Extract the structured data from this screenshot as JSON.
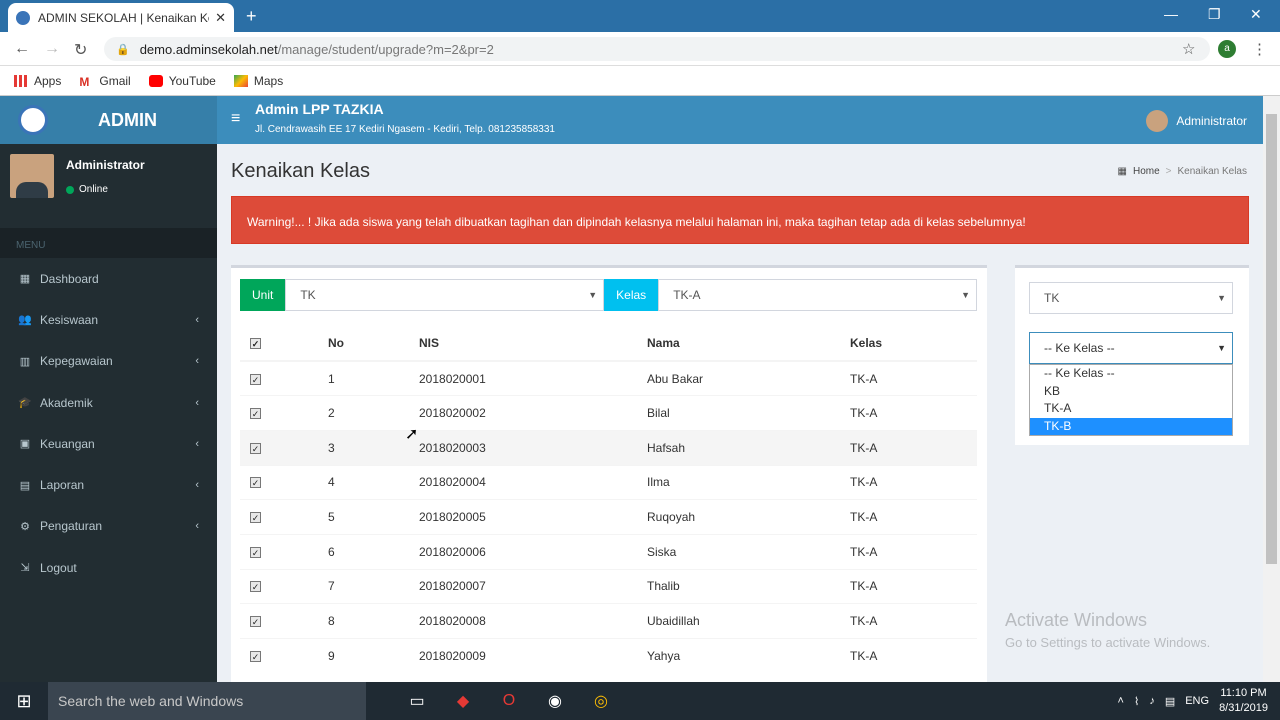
{
  "browser": {
    "tab_title": "ADMIN SEKOLAH | Kenaikan Kel",
    "url_host": "demo.adminsekolah.net",
    "url_path": "/manage/student/upgrade?m=2&pr=2",
    "bookmarks": [
      "Apps",
      "Gmail",
      "YouTube",
      "Maps"
    ],
    "profile_initial": "a"
  },
  "app": {
    "brand": "ADMIN",
    "header_title": "Admin LPP TAZKIA",
    "header_subtitle": "Jl. Cendrawasih EE 17 Kediri Ngasem - Kediri, Telp. 081235858331",
    "header_user": "Administrator"
  },
  "sidebar": {
    "user_name": "Administrator",
    "user_status": "Online",
    "menu_header": "MENU",
    "items": [
      {
        "label": "Dashboard",
        "icon": "dashboard-icon",
        "arrow": false
      },
      {
        "label": "Kesiswaan",
        "icon": "users-icon",
        "arrow": true
      },
      {
        "label": "Kepegawaian",
        "icon": "building-icon",
        "arrow": true
      },
      {
        "label": "Akademik",
        "icon": "graduation-cap-icon",
        "arrow": true
      },
      {
        "label": "Keuangan",
        "icon": "money-icon",
        "arrow": true
      },
      {
        "label": "Laporan",
        "icon": "file-icon",
        "arrow": true
      },
      {
        "label": "Pengaturan",
        "icon": "gear-icon",
        "arrow": true
      },
      {
        "label": "Logout",
        "icon": "logout-icon",
        "arrow": false
      }
    ]
  },
  "page": {
    "title": "Kenaikan Kelas",
    "breadcrumb_home": "Home",
    "breadcrumb_sep": ">",
    "breadcrumb_current": "Kenaikan Kelas",
    "alert": "Warning!... ! Jika ada siswa yang telah dibuatkan tagihan dan dipindah kelasnya melalui halaman ini, maka tagihan tetap ada di kelas sebelumnya!"
  },
  "filters": {
    "unit_label": "Unit",
    "unit_value": "TK",
    "kelas_label": "Kelas",
    "kelas_value": "TK-A"
  },
  "table": {
    "headers": [
      "No",
      "NIS",
      "Nama",
      "Kelas"
    ],
    "rows": [
      [
        "1",
        "2018020001",
        "Abu Bakar",
        "TK-A"
      ],
      [
        "2",
        "2018020002",
        "Bilal",
        "TK-A"
      ],
      [
        "3",
        "2018020003",
        "Hafsah",
        "TK-A"
      ],
      [
        "4",
        "2018020004",
        "Ilma",
        "TK-A"
      ],
      [
        "5",
        "2018020005",
        "Ruqoyah",
        "TK-A"
      ],
      [
        "6",
        "2018020006",
        "Siska",
        "TK-A"
      ],
      [
        "7",
        "2018020007",
        "Thalib",
        "TK-A"
      ],
      [
        "8",
        "2018020008",
        "Ubaidillah",
        "TK-A"
      ],
      [
        "9",
        "2018020009",
        "Yahya",
        "TK-A"
      ]
    ]
  },
  "side": {
    "unit_value": "TK",
    "target_value": "-- Ke Kelas --",
    "options": [
      "-- Ke Kelas --",
      "KB",
      "TK-A",
      "TK-B"
    ],
    "highlighted": "TK-B"
  },
  "watermark": {
    "title": "Activate Windows",
    "subtitle": "Go to Settings to activate Windows."
  },
  "taskbar": {
    "search": "Search the web and Windows",
    "lang": "ENG",
    "time": "11:10 PM",
    "date": "8/31/2019"
  },
  "colors": {
    "header": "#3c8dbc",
    "sidebar": "#222d32",
    "alert": "#dd4b39",
    "unit_label": "#00a65a",
    "kelas_label": "#00c0ef",
    "highlight": "#1e90ff"
  }
}
